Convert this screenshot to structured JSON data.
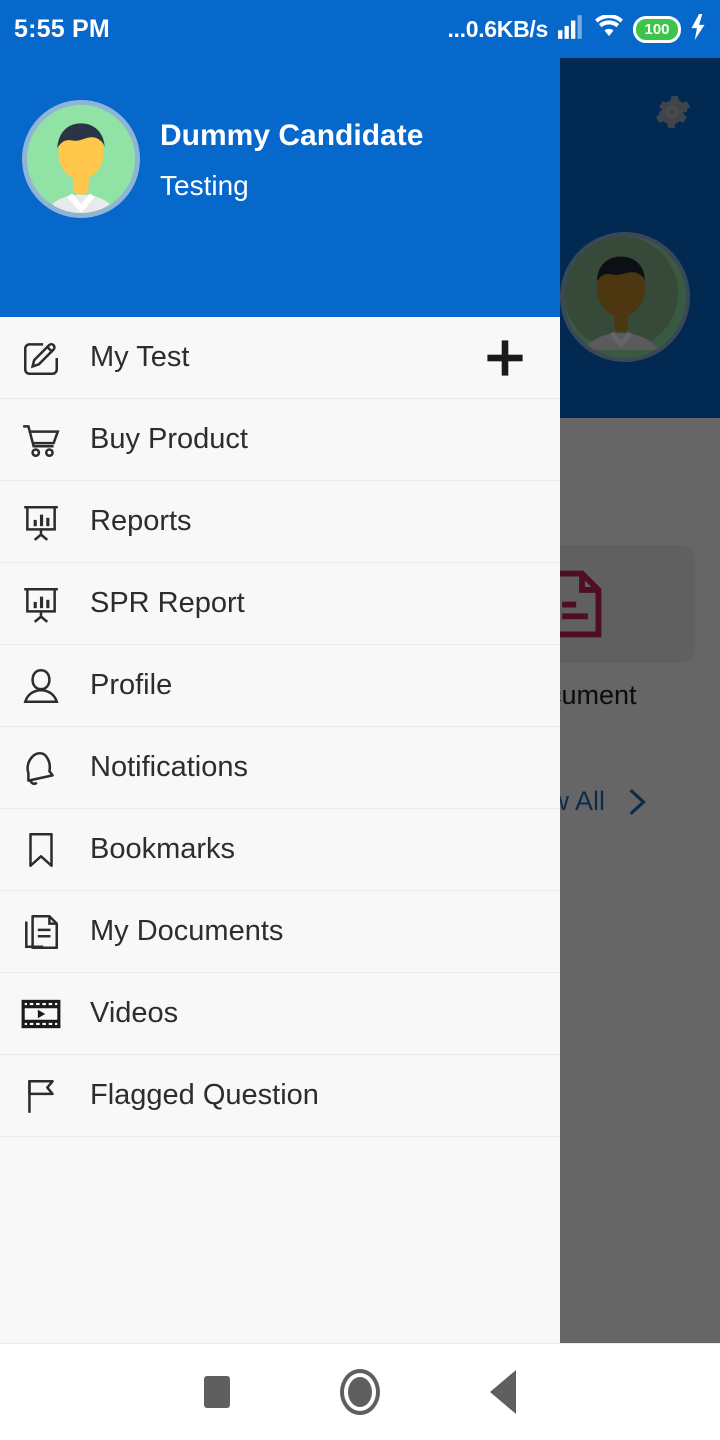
{
  "status_bar": {
    "time": "5:55 PM",
    "network_speed": "...0.6KB/s",
    "battery_level": "100",
    "icons": [
      "signal-bars-icon",
      "wifi-icon",
      "battery-icon",
      "charging-bolt-icon"
    ]
  },
  "drawer": {
    "user_name": "Dummy Candidate",
    "user_role": "Testing",
    "avatar_name": "user-avatar",
    "add_button_label": "+",
    "items": [
      {
        "label": "My Test",
        "icon": "edit-square-icon",
        "has_add_button": true
      },
      {
        "label": "Buy Product",
        "icon": "shopping-cart-icon",
        "has_add_button": false
      },
      {
        "label": "Reports",
        "icon": "presentation-chart-icon",
        "has_add_button": false
      },
      {
        "label": "SPR Report",
        "icon": "presentation-chart-icon",
        "has_add_button": false
      },
      {
        "label": "Profile",
        "icon": "person-icon",
        "has_add_button": false
      },
      {
        "label": "Notifications",
        "icon": "bell-icon",
        "has_add_button": false
      },
      {
        "label": "Bookmarks",
        "icon": "bookmark-icon",
        "has_add_button": false
      },
      {
        "label": "My Documents",
        "icon": "documents-stack-icon",
        "has_add_button": false
      },
      {
        "label": "Videos",
        "icon": "film-strip-icon",
        "has_add_button": false
      },
      {
        "label": "Flagged Question",
        "icon": "flag-icon",
        "has_add_button": false
      }
    ]
  },
  "background_app": {
    "gear_icon": "gear-icon",
    "avatar_name": "user-avatar",
    "document_card": {
      "icon": "document-icon",
      "label": "Document"
    },
    "view_all": {
      "label": "View All",
      "icon": "chevron-right-icon"
    }
  },
  "nav_bar": {
    "recents_label": "recents-square",
    "home_label": "home-circle",
    "back_label": "back-triangle"
  },
  "colors": {
    "primary_blue": "#0768cb",
    "drawer_bg": "#f8f8f8",
    "document_red": "#c2275a",
    "link_blue": "#1f6fb8",
    "battery_green": "#3dc44a"
  }
}
